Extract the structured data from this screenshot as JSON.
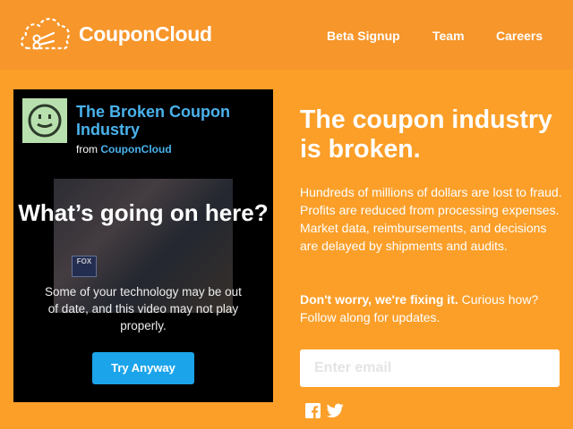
{
  "header": {
    "brand": "CouponCloud",
    "nav": [
      "Beta Signup",
      "Team",
      "Careers"
    ]
  },
  "video": {
    "title": "The Broken Coupon Industry",
    "from_label": "from",
    "from_brand": "CouponCloud",
    "heading": "What’s going on here?",
    "message": "Some of your technology may be out of date, and this video may not play properly.",
    "button": "Try Anyway",
    "bg_badge": "FOX"
  },
  "main": {
    "headline": "The coupon industry is broken.",
    "paragraph1": "Hundreds of millions of dollars are lost to fraud. Profits are reduced from processing expenses. Market data, reimbursements, and decisions are delayed by shipments and audits.",
    "paragraph2_bold": "Don't worry, we're fixing it.",
    "paragraph2_rest": " Curious how? Follow along for updates.",
    "email_placeholder": "Enter email"
  },
  "social": [
    "facebook-icon",
    "twitter-icon"
  ],
  "colors": {
    "background": "#fb9f29",
    "header": "#f6962b",
    "accent_blue": "#1ba4ea",
    "link_blue": "#4ab2ec"
  }
}
